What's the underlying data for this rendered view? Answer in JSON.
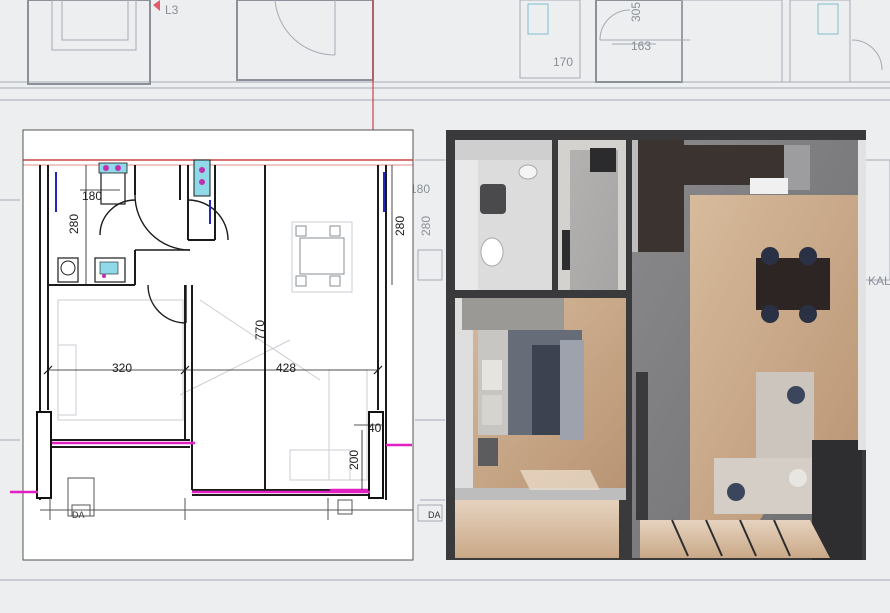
{
  "background_plan": {
    "top_labels": {
      "level": "L3",
      "d170": "170",
      "d163": "163",
      "d305": "305"
    },
    "right_labels": {
      "kal": "KAL"
    }
  },
  "floor_plan": {
    "dimensions": {
      "d180": "180",
      "d280": "280",
      "d320": "320",
      "d770": "770",
      "d428": "428",
      "d40": "40",
      "d200": "200"
    },
    "ghost_labels": {
      "g180": "180",
      "g280": "280"
    },
    "small_labels": {
      "da_left": "DA",
      "da_right": "DA"
    }
  },
  "render_3d": {
    "rooms": [
      "bathroom",
      "closet",
      "bedroom",
      "kitchen",
      "dining",
      "living"
    ]
  },
  "colors": {
    "wall": "#1b1b1b",
    "magenta": "#e020c0",
    "red_line": "#c02020",
    "floor_wood": "#c8a889",
    "floor_light": "#d9c6b0",
    "render_wall": "#2e2e30",
    "kitchen_dark": "#3a3330"
  }
}
